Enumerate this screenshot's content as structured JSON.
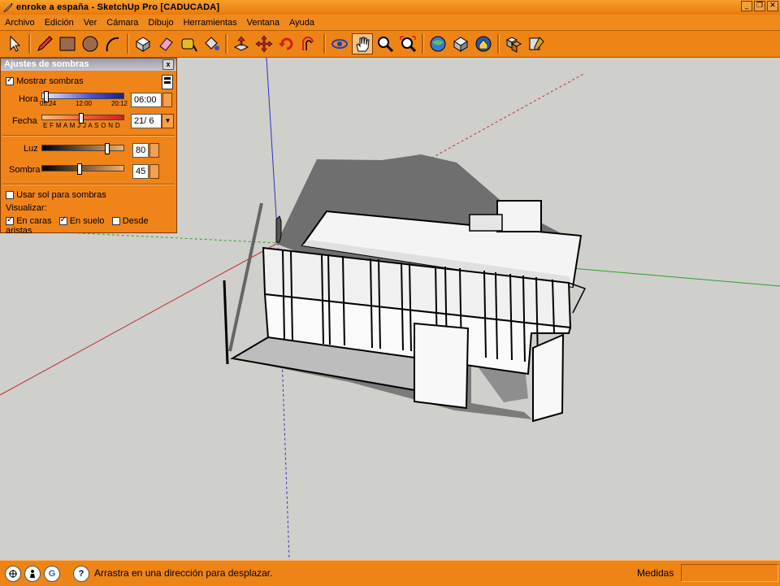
{
  "window": {
    "title": "enroke a españa - SketchUp Pro [CADUCADA]",
    "controls": [
      "_",
      "❐",
      "✕"
    ]
  },
  "menu": [
    "Archivo",
    "Edición",
    "Ver",
    "Cámara",
    "Dibujo",
    "Herramientas",
    "Ventana",
    "Ayuda"
  ],
  "toolbar": {
    "tools": [
      "select-icon",
      "pencil-icon",
      "rectangle-icon",
      "circle-icon",
      "arc-icon",
      "make-component-icon",
      "eraser-icon",
      "tape-measure-icon",
      "paint-bucket-icon",
      "push-pull-icon",
      "move-icon",
      "rotate-icon",
      "offset-icon",
      "orbit-icon",
      "pan-icon",
      "zoom-icon",
      "zoom-extents-icon",
      "get-models-icon",
      "share-model-icon",
      "google-earth-icon",
      "components-icon",
      "styles-icon"
    ]
  },
  "shadow_panel": {
    "title": "Ajustes de sombras",
    "close": "x",
    "mostrar_sombras": "Mostrar sombras",
    "hora_label": "Hora",
    "hora_ticks": [
      "05:24",
      "12:00",
      "20:12"
    ],
    "hora_value": "06:00",
    "fecha_label": "Fecha",
    "fecha_months": "E F M A M J J A S O N D",
    "fecha_value": "21/ 6",
    "luz_label": "Luz",
    "luz_value": "80",
    "sombra_label": "Sombra",
    "sombra_value": "45",
    "usar_sol": "Usar sol para sombras",
    "visualizar": "Visualizar:",
    "en_caras": "En caras",
    "en_suelo": "En suelo",
    "desde_aristas": "Desde aristas",
    "checks": {
      "mostrar_sombras": true,
      "usar_sol": false,
      "en_caras": true,
      "en_suelo": true,
      "desde_aristas": false
    },
    "sliders": {
      "hora": 0.02,
      "fecha": 0.47,
      "luz": 0.8,
      "sombra": 0.45
    }
  },
  "status": {
    "hint": "Arrastra en una dirección para desplazar.",
    "measure_label": "Medidas",
    "measure_value": ""
  },
  "colors": {
    "accent": "#ee8416",
    "axis_red": "#c83030",
    "axis_green": "#30a030",
    "axis_blue": "#3030c8"
  }
}
